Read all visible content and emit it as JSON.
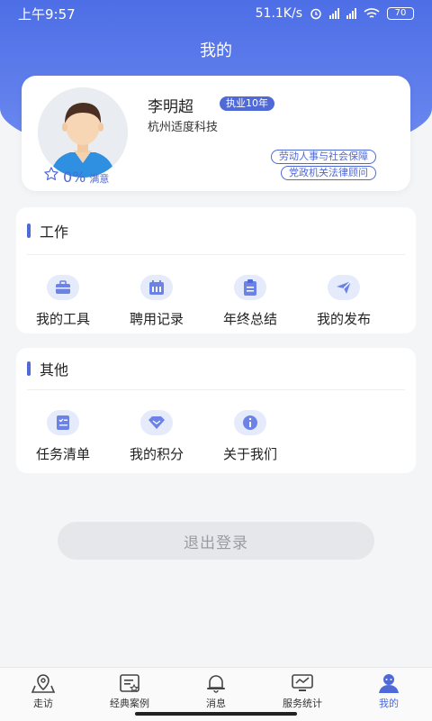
{
  "status_bar": {
    "time": "上午9:57",
    "speed": "51.1K/s",
    "battery": "70"
  },
  "header": {
    "title": "我的"
  },
  "profile": {
    "name": "李明超",
    "badge": "执业10年",
    "company": "杭州适度科技",
    "satisfaction_value": "0%",
    "satisfaction_label": "满意",
    "tags": [
      "劳动人事与社会保障",
      "党政机关法律顾问"
    ]
  },
  "work": {
    "title": "工作",
    "items": [
      {
        "label": "我的工具",
        "icon": "toolbox-icon"
      },
      {
        "label": "聘用记录",
        "icon": "calendar-icon"
      },
      {
        "label": "年终总结",
        "icon": "clipboard-icon"
      },
      {
        "label": "我的发布",
        "icon": "send-icon"
      }
    ]
  },
  "other": {
    "title": "其他",
    "items": [
      {
        "label": "任务清单",
        "icon": "task-list-icon"
      },
      {
        "label": "我的积分",
        "icon": "diamond-icon"
      },
      {
        "label": "关于我们",
        "icon": "info-icon"
      }
    ]
  },
  "logout_label": "退出登录",
  "tabbar": [
    {
      "label": "走访",
      "icon": "map-pin-icon",
      "active": false
    },
    {
      "label": "经典案例",
      "icon": "case-icon",
      "active": false
    },
    {
      "label": "消息",
      "icon": "bell-icon",
      "active": false
    },
    {
      "label": "服务统计",
      "icon": "monitor-icon",
      "active": false
    },
    {
      "label": "我的",
      "icon": "user-icon",
      "active": true
    }
  ],
  "colors": {
    "accent": "#4f69d6",
    "header_gradient_start": "#4d6ee6",
    "header_gradient_end": "#6f8cf0"
  }
}
